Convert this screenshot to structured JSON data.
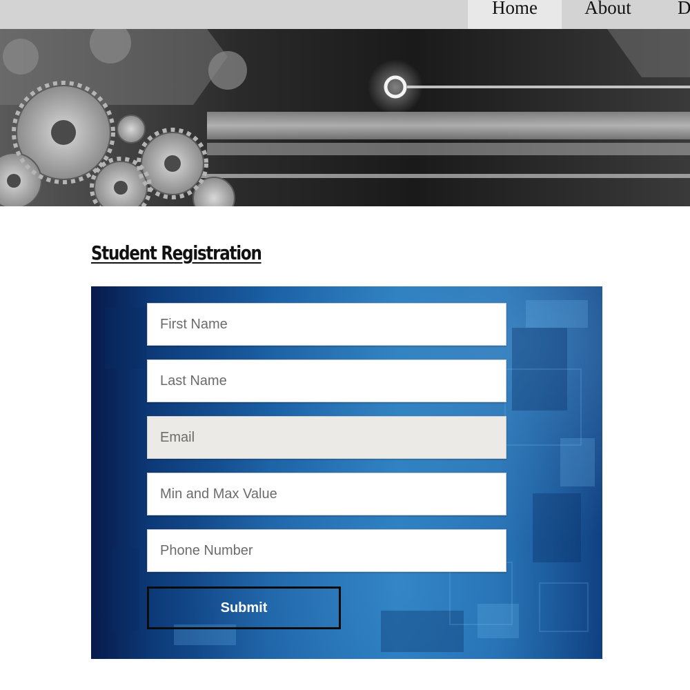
{
  "nav": {
    "items": [
      {
        "label": "Home",
        "active": true
      },
      {
        "label": "About",
        "active": false
      },
      {
        "label": "D",
        "active": false
      }
    ]
  },
  "banner": {
    "description_icon": "gears-circuit-banner"
  },
  "page": {
    "title": "Student Registration"
  },
  "form": {
    "fields": [
      {
        "placeholder": "First Name",
        "value": ""
      },
      {
        "placeholder": "Last Name",
        "value": ""
      },
      {
        "placeholder": "Email",
        "value": ""
      },
      {
        "placeholder": "Min and Max Value",
        "value": ""
      },
      {
        "placeholder": "Phone Number",
        "value": ""
      }
    ],
    "submit_label": "Submit"
  },
  "colors": {
    "nav_bg": "#d3d3d3",
    "nav_active_bg": "#e8e8e8",
    "panel_blue": "#1a5fa3",
    "focused_field_bg": "#ebeae6"
  }
}
